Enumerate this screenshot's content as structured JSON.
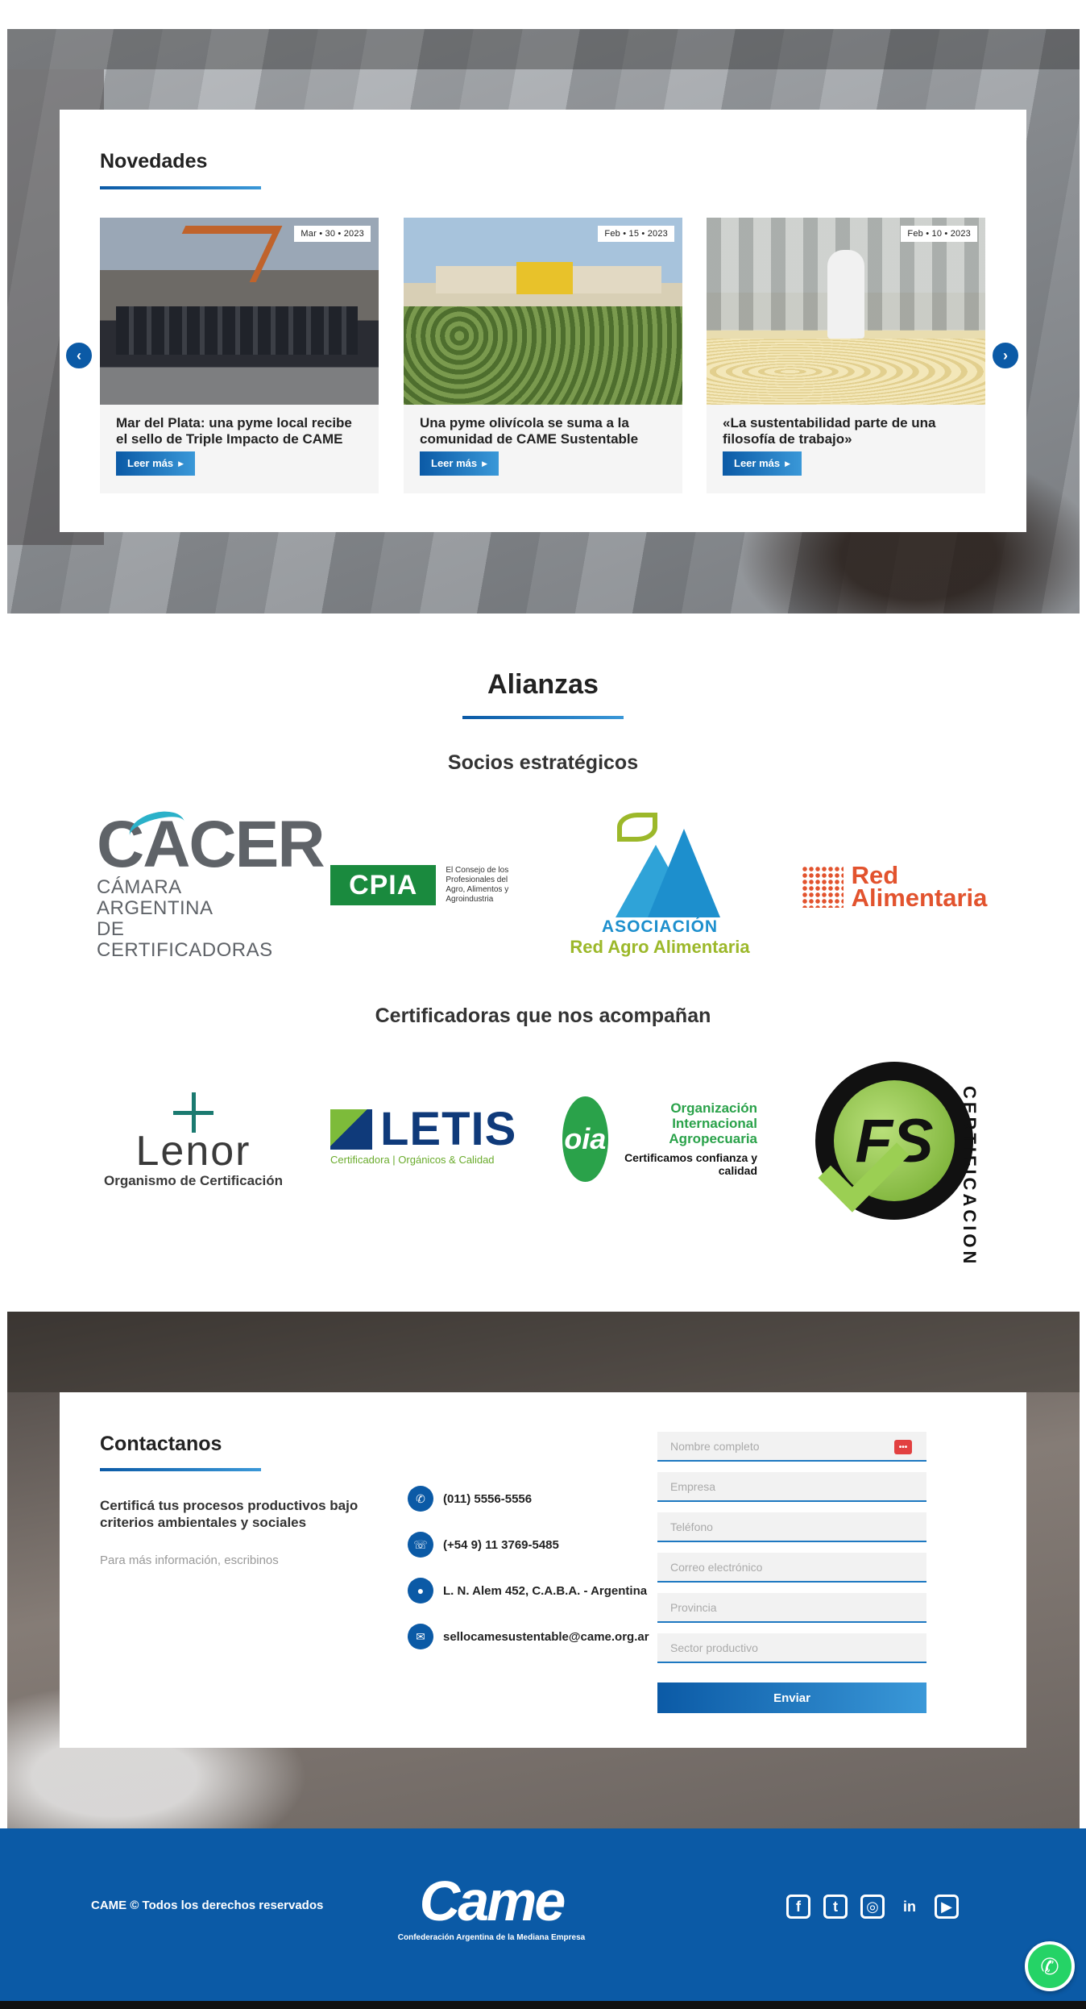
{
  "novedades": {
    "title": "Novedades",
    "items": [
      {
        "date": "Mar • 30 • 2023",
        "title": "Mar del Plata: una pyme local recibe el sello de Triple Impacto de CAME",
        "cta": "Leer más"
      },
      {
        "date": "Feb • 15 • 2023",
        "title": "Una pyme olivícola se suma a la comunidad de CAME Sustentable",
        "cta": "Leer más"
      },
      {
        "date": "Feb • 10 • 2023",
        "title": "«La sustentabilidad parte de una filosofía de trabajo»",
        "cta": "Leer más"
      }
    ],
    "prev_icon": "chevron-left-icon",
    "next_icon": "chevron-right-icon"
  },
  "alianzas": {
    "title": "Alianzas",
    "socios_title": "Socios estratégicos",
    "socios": {
      "cacer": {
        "name": "CACER",
        "sub1": "CÁMARA ARGENTINA",
        "sub2": "DE CERTIFICADORAS"
      },
      "cpia": {
        "name": "CPIA",
        "sub": "El Consejo de los Profesionales del Agro, Alimentos y Agroindustria"
      },
      "red_agro": {
        "line1": "ASOCIACIÓN",
        "line2": "Red Agro Alimentaria"
      },
      "red_alimentaria": {
        "line1": "Red",
        "line2": "Alimentaria"
      }
    },
    "certificadoras_title": "Certificadoras que nos acompañan",
    "certificadoras": {
      "lenor": {
        "name": "Lenor",
        "sub": "Organismo de Certificación"
      },
      "letis": {
        "name": "LETIS",
        "sub": "Certificadora | Orgánicos & Calidad"
      },
      "oia": {
        "mark": "oia",
        "line1": "Organización Internacional Agropecuaria",
        "line2": "Certificamos confianza y calidad"
      },
      "fs": {
        "mark": "FS",
        "label": "CERTIFICACION"
      }
    }
  },
  "contact": {
    "title": "Contactanos",
    "lead": "Certificá tus procesos productivos bajo criterios ambientales y sociales",
    "info": "Para más información, escribinos",
    "phone": "(011) 5556-5556",
    "whatsapp": "(+54 9) 11 3769-5485",
    "address": "L. N. Alem 452, C.A.B.A. - Argentina",
    "email": "sellocamesustentable@came.org.ar",
    "form": {
      "name_placeholder": "Nombre completo",
      "company_placeholder": "Empresa",
      "phone_placeholder": "Teléfono",
      "email_placeholder": "Correo electrónico",
      "province_placeholder": "Provincia",
      "sector_placeholder": "Sector productivo",
      "submit": "Enviar"
    }
  },
  "footer": {
    "copyright": "CAME © Todos los derechos reservados",
    "logo_word": "Came",
    "logo_tag": "Confederación Argentina de la Mediana Empresa",
    "socials": [
      "facebook-icon",
      "twitter-icon",
      "instagram-icon",
      "linkedin-icon",
      "youtube-icon"
    ]
  },
  "colors": {
    "brand_blue": "#0b5aa6",
    "accent_light_blue": "#3a98d8",
    "whatsapp_green": "#25d366"
  }
}
